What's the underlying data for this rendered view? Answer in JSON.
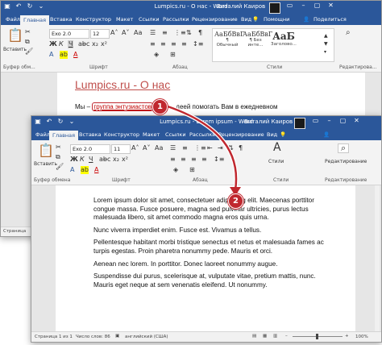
{
  "back_window": {
    "title": "Lumpics.ru - О нас - Word",
    "user": "Виталий Каиров",
    "tabs": [
      "Файл",
      "Главная",
      "Вставка",
      "Конструктор",
      "Макет",
      "Ссылки",
      "Рассылки",
      "Рецензирование",
      "Вид"
    ],
    "active_tab": "Главная",
    "tell_me": "Помощни",
    "share": "Поделиться",
    "font_name": "Exo 2.0",
    "font_size": "12",
    "groups": {
      "clipboard": "Буфер обм...",
      "font": "Шрифт",
      "paragraph": "Абзац",
      "styles": "Стили",
      "editing": "Редактирова..."
    },
    "paste_label": "Вставить",
    "styles": [
      {
        "preview": "АаБбВвГ",
        "label": "¶ Обычный"
      },
      {
        "preview": "АаБбВвГ",
        "label": "¶ Без инте..."
      },
      {
        "preview": "АаБ",
        "label": "Заголово..."
      }
    ],
    "doc_heading": "Lumpics.ru - О нас",
    "doc_line_start": "Мы –",
    "doc_link": "группа энтузиастов",
    "doc_line_end": "деей помогать Вам в ежедневном",
    "status_left": "Страница"
  },
  "front_window": {
    "title": "Lumpics.ru - Lorem ipsum - Word",
    "user": "Виталий Каиров",
    "tabs": [
      "Файл",
      "Главная",
      "Вставка",
      "Конструктор",
      "Макет",
      "Ссылки",
      "Рассылки",
      "Рецензирование",
      "Вид"
    ],
    "active_tab": "Главная",
    "font_name": "Exo 2.0",
    "font_size": "11",
    "groups": {
      "clipboard": "Буфер обмена",
      "font": "Шрифт",
      "paragraph": "Абзац",
      "styles": "Стили",
      "editing": "Редактирование"
    },
    "paste_label": "Вставить",
    "styles_button": "Стили",
    "editing_button": "Редактирование",
    "paragraphs": [
      "Lorem ipsum dolor sit amet, consectetuer adipiscing elit. Maecenas porttitor congue massa. Fusce posuere, magna sed pulvinar ultricies, purus lectus malesuada libero, sit amet commodo magna eros quis urna.",
      "Nunc viverra imperdiet enim. Fusce est. Vivamus a tellus.",
      "Pellentesque habitant morbi tristique senectus et netus et malesuada fames ac turpis egestas. Proin pharetra nonummy pede. Mauris et orci.",
      "Aenean nec lorem. In porttitor. Donec laoreet nonummy augue.",
      "Suspendisse dui purus, scelerisque at, vulputate vitae, pretium mattis, nunc. Mauris eget neque at sem venenatis eleifend. Ut nonummy."
    ],
    "status": {
      "page": "Страница 1 из 1",
      "words": "Число слов: 86",
      "lang": "английский (США)",
      "zoom": "100%"
    }
  },
  "callouts": [
    "1",
    "2"
  ],
  "colors": {
    "ribbon_blue": "#2b579a",
    "callout_red": "#c0282f",
    "heading_orange": "#c0504d"
  }
}
